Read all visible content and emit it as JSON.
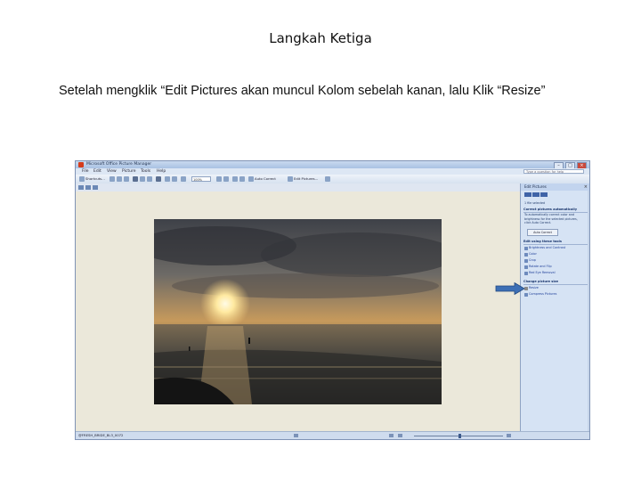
{
  "heading": "Langkah Ketiga",
  "instruction": "Setelah mengklik “Edit Pictures akan muncul Kolom sebelah kanan, lalu Klik “Resize”",
  "window": {
    "title": "Microsoft Office Picture Manager",
    "menu": [
      "File",
      "Edit",
      "View",
      "Picture",
      "Tools",
      "Help"
    ],
    "help_placeholder": "Type a question for help"
  },
  "toolbar": {
    "shortcuts_label": "Shortcuts...",
    "zoom": "100%",
    "auto_correct_label": "Auto Correct",
    "edit_pictures_label": "Edit Pictures..."
  },
  "status": {
    "filename": "@FRESH_BRIDE_BL3_0072"
  },
  "task_pane": {
    "title": "Edit Pictures",
    "close": "×",
    "selected_count": "1 file selected",
    "correct_heading": "Correct pictures automatically",
    "correct_desc": [
      "To automatically correct color and",
      "brightness for the selected pictures,",
      "click Auto Correct."
    ],
    "auto_correct_button": "Auto Correct",
    "edit_tools_heading": "Edit using these tools",
    "edit_tools": [
      "Brightness and Contrast",
      "Color",
      "Crop",
      "Rotate and Flip",
      "Red Eye Removal"
    ],
    "size_heading": "Change picture size",
    "size_tools": [
      "Resize",
      "Compress Pictures"
    ]
  },
  "colors": {
    "pointer_arrow": "#3d6fb5",
    "title_bar": "#a9c1e3",
    "work_area": "#ebe8da",
    "task_pane": "#d6e3f4"
  }
}
